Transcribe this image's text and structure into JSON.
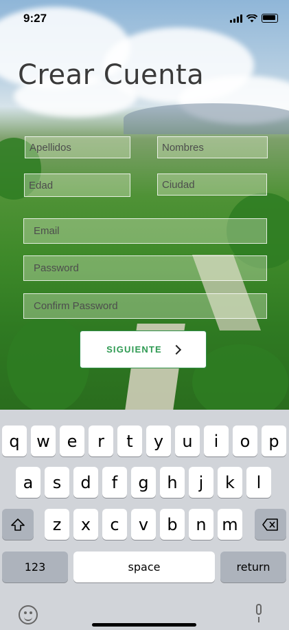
{
  "status": {
    "time": "9:27"
  },
  "title": "Crear Cuenta",
  "form": {
    "apellidos_placeholder": "Apellidos",
    "nombres_placeholder": "Nombres",
    "edad_placeholder": "Edad",
    "ciudad_placeholder": "Ciudad",
    "email_placeholder": "Email",
    "password_placeholder": "Password",
    "confirm_placeholder": "Confirm Password"
  },
  "next_button": {
    "label": "SIGUIENTE"
  },
  "keyboard": {
    "row1": [
      "q",
      "w",
      "e",
      "r",
      "t",
      "y",
      "u",
      "i",
      "o",
      "p"
    ],
    "row2": [
      "a",
      "s",
      "d",
      "f",
      "g",
      "h",
      "j",
      "k",
      "l"
    ],
    "row3": [
      "z",
      "x",
      "c",
      "v",
      "b",
      "n",
      "m"
    ],
    "numbers_label": "123",
    "space_label": "space",
    "return_label": "return"
  }
}
